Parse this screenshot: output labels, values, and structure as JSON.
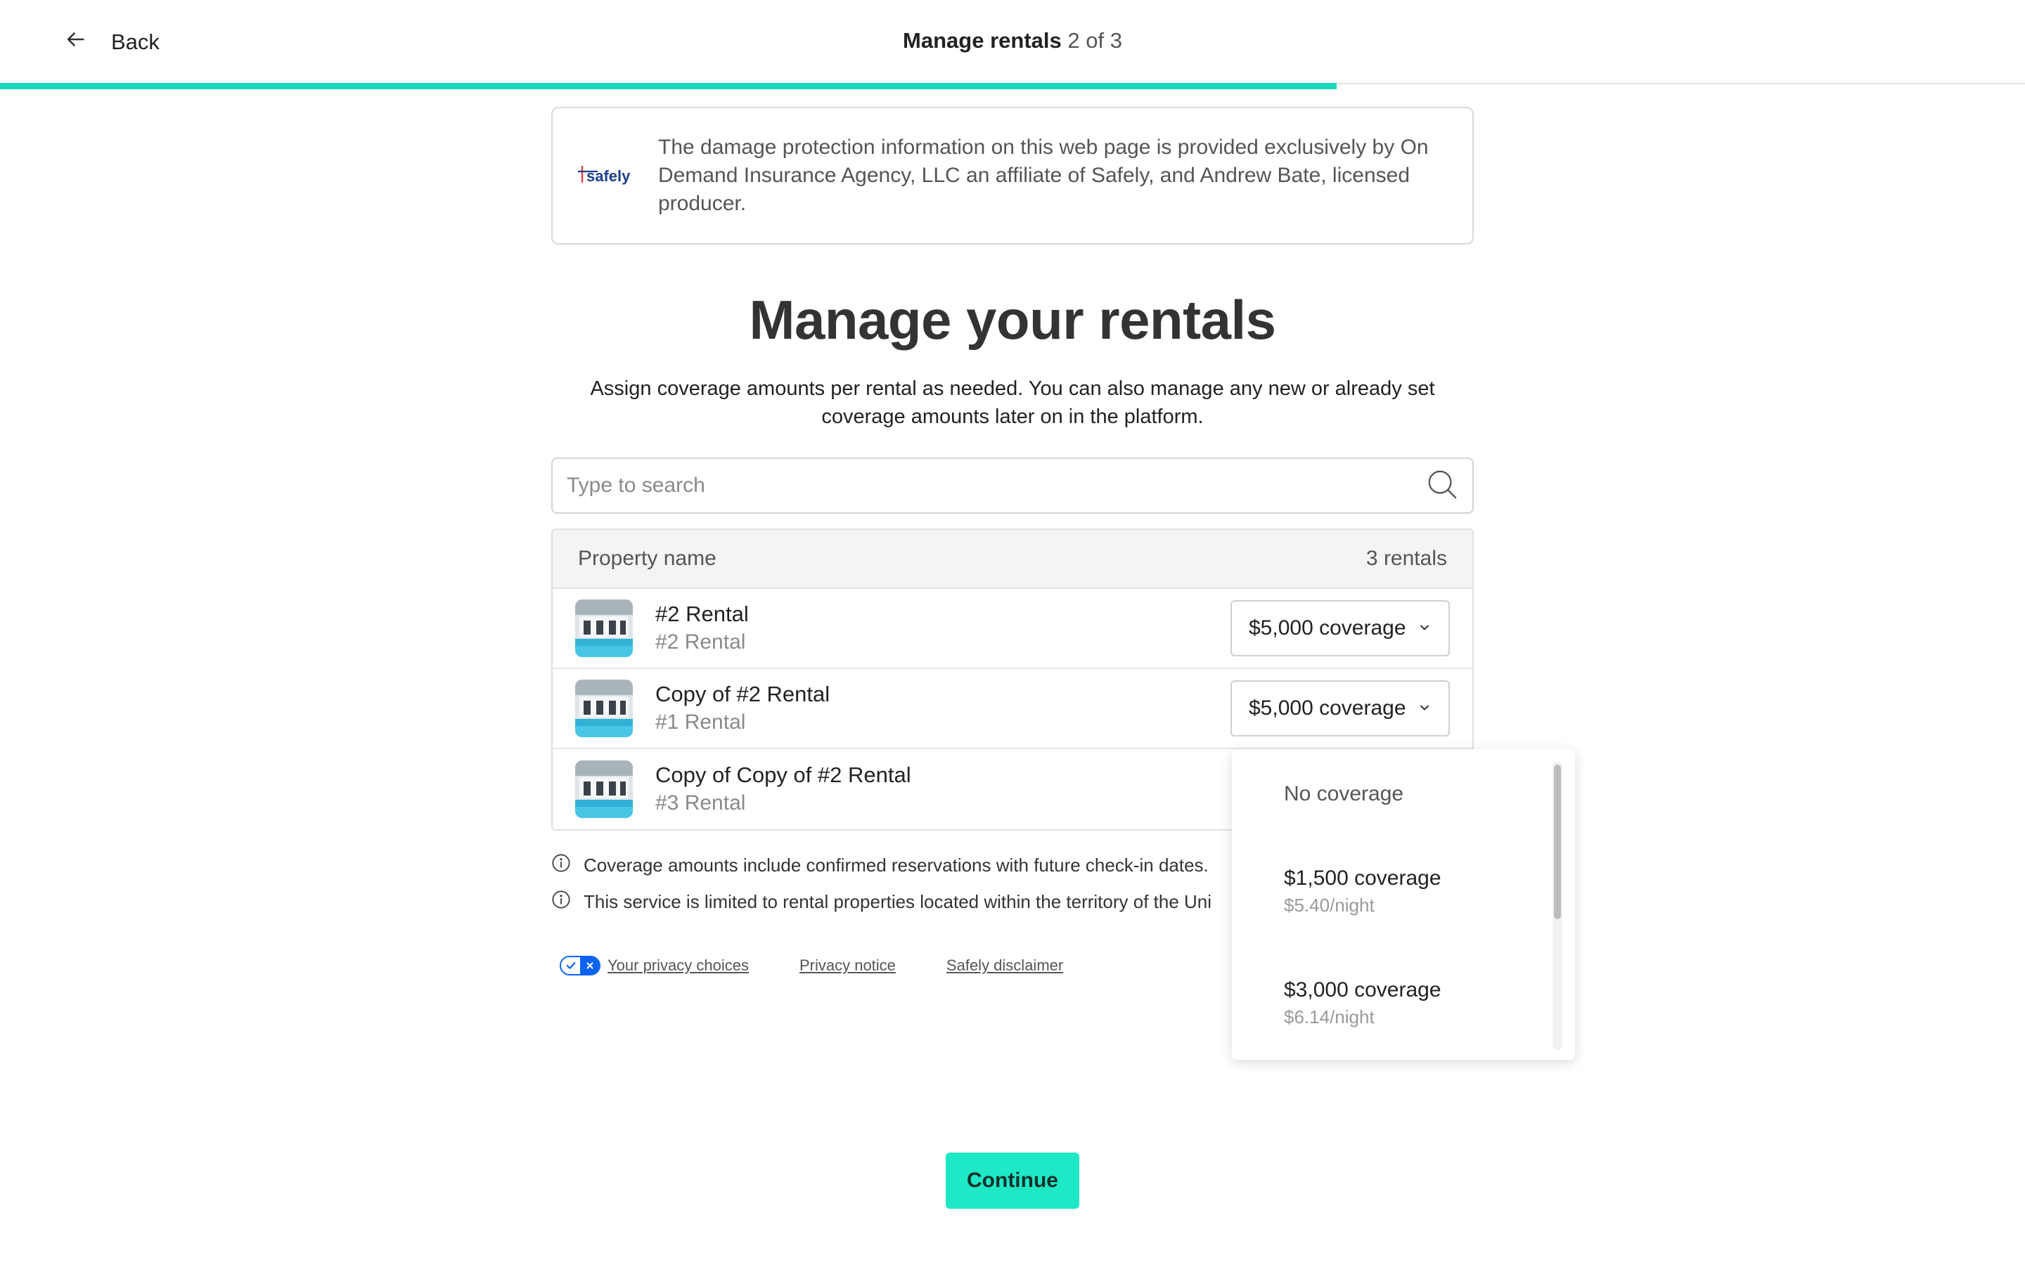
{
  "header": {
    "back_label": "Back",
    "title": "Manage rentals",
    "step": "2 of 3",
    "progress_fraction": 0.66
  },
  "disclaimer": {
    "logo_text": "safely",
    "text": "The damage protection information on this web page is provided exclusively by On Demand Insurance Agency, LLC an affiliate of Safely, and Andrew Bate, licensed producer."
  },
  "main": {
    "title": "Manage your rentals",
    "subtitle": "Assign coverage amounts per rental as needed. You can also manage any new or already set coverage amounts later on in the platform."
  },
  "search": {
    "placeholder": "Type to search",
    "value": ""
  },
  "table": {
    "header_label": "Property name",
    "count_label": "3 rentals",
    "rows": [
      {
        "title": "#2 Rental",
        "subtitle": "#2 Rental",
        "coverage": "$5,000 coverage"
      },
      {
        "title": "Copy of #2 Rental",
        "subtitle": "#1 Rental",
        "coverage": "$5,000 coverage"
      },
      {
        "title": "Copy of Copy of #2 Rental",
        "subtitle": "#3 Rental",
        "coverage": ""
      }
    ]
  },
  "dropdown": {
    "options": [
      {
        "label": "No coverage",
        "price": ""
      },
      {
        "label": "$1,500 coverage",
        "price": "$5.40/night"
      },
      {
        "label": "$3,000 coverage",
        "price": "$6.14/night"
      }
    ]
  },
  "notes": [
    "Coverage amounts include confirmed reservations with future check-in dates.",
    "This service is limited to rental properties located within the territory of the Uni"
  ],
  "footer": {
    "privacy_choices": "Your privacy choices",
    "privacy_notice": "Privacy notice",
    "safely_disclaimer": "Safely disclaimer"
  },
  "actions": {
    "continue_label": "Continue"
  },
  "colors": {
    "accent": "#1bd9bd",
    "button": "#1ee8c6",
    "privacy_toggle": "#0b63f0"
  }
}
